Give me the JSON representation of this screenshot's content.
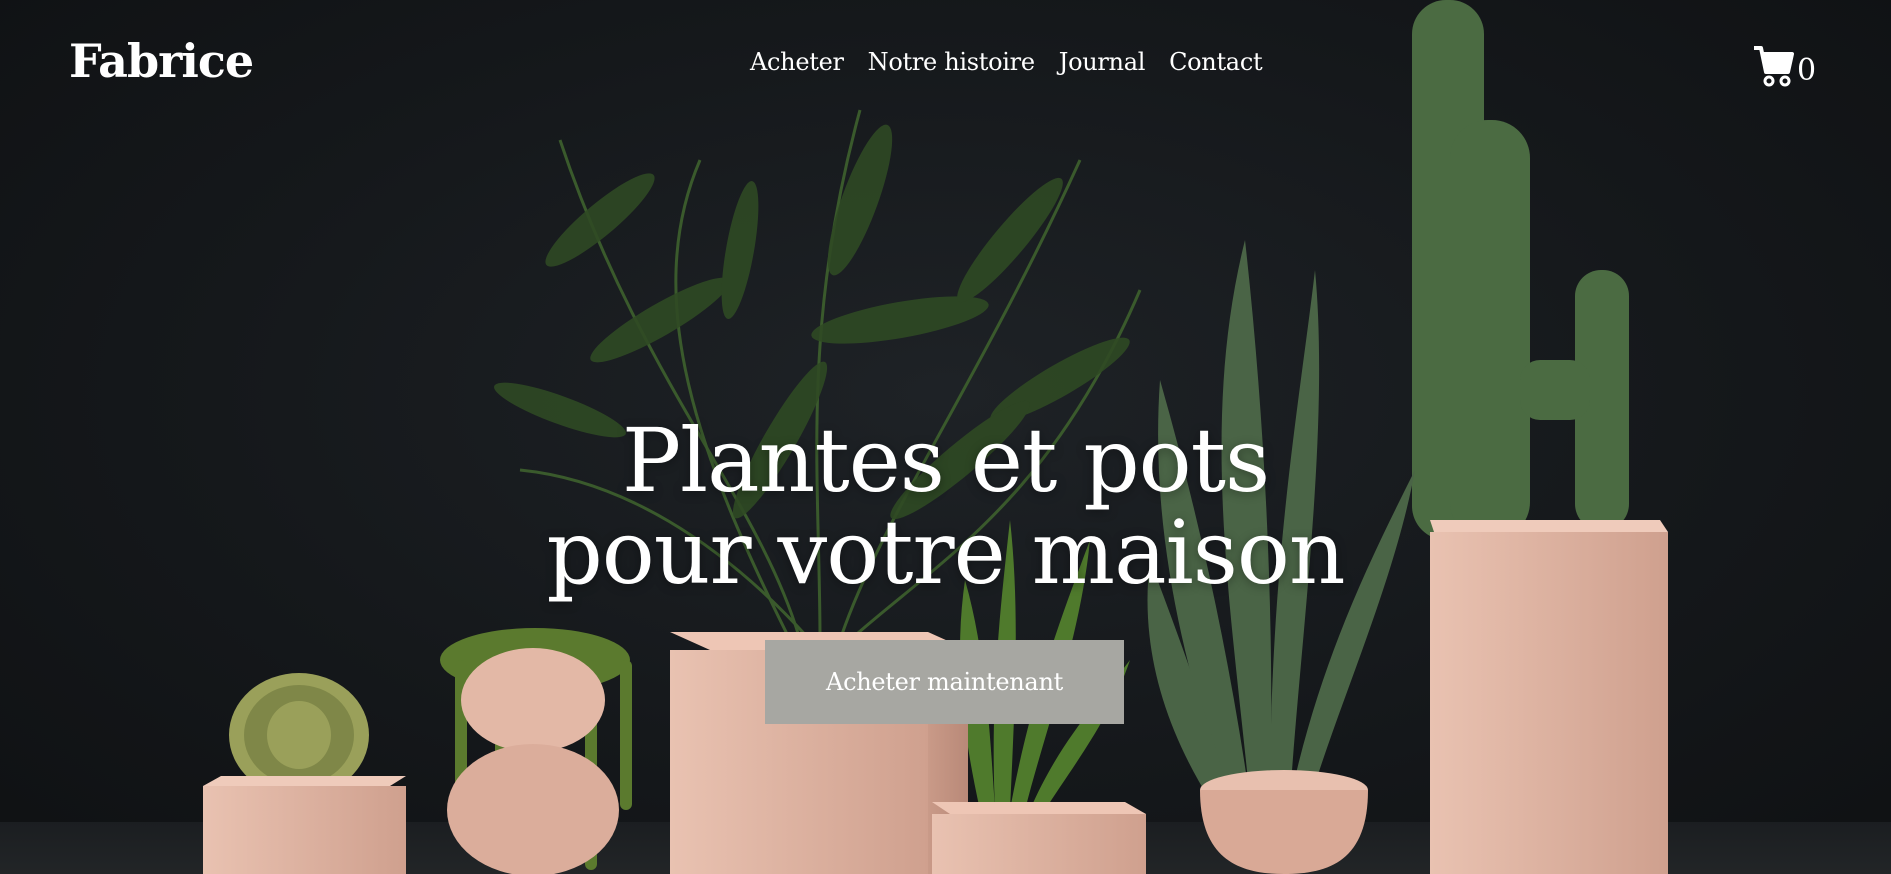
{
  "header": {
    "logo": "Fabrice",
    "nav": [
      "Acheter",
      "Notre histoire",
      "Journal",
      "Contact"
    ],
    "cart_count": "0"
  },
  "hero": {
    "headline_line1": "Plantes et pots",
    "headline_line2": "pour votre maison",
    "cta_label": "Acheter maintenant"
  },
  "colors": {
    "background": "#14171a",
    "pot": "#e3b8a6",
    "button": "#a7a7a2",
    "text": "#ffffff"
  }
}
